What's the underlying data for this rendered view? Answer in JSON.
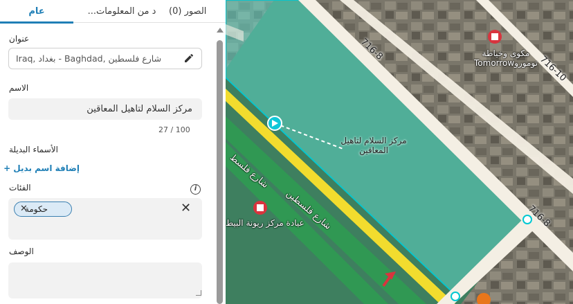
{
  "tabs": {
    "photos": "الصور (0)",
    "more_info": "...د من المعلومات",
    "general": "عام"
  },
  "address": {
    "label": "عنوان",
    "value": "Iraq, بغداد - Baghdad, شارع فلسطين"
  },
  "name": {
    "label": "الاسم",
    "value": "مركز السلام لتاهيل المعاقين",
    "counter": "27 / 100"
  },
  "alt_names": {
    "label": "الأسماء البديلة",
    "add_label": "إضافة اسم بديل +"
  },
  "categories": {
    "label": "الفئات",
    "chips": [
      "حكومة"
    ]
  },
  "description": {
    "label": "الوصف",
    "value": ""
  },
  "map": {
    "place_label": "مركز السلام لتاهيل المعاقين",
    "shop_label_1": "مكوى وخياطة توموروTomorrow",
    "shop_label_2": "عيادة مركز ريونة البيط",
    "road_1": "716-8",
    "road_2": "716-10",
    "road_3": "716-8",
    "street": "شارع فلسطين",
    "street_2": "شارع فلسط",
    "colors": {
      "polygon_fill": "#5fd6c7",
      "polygon_stroke": "#00c8d2",
      "road_yellow": "#f2dc2e",
      "road_green": "#3c9a57",
      "accent": "#1f7fb6",
      "pin_red": "#d8343e"
    }
  }
}
